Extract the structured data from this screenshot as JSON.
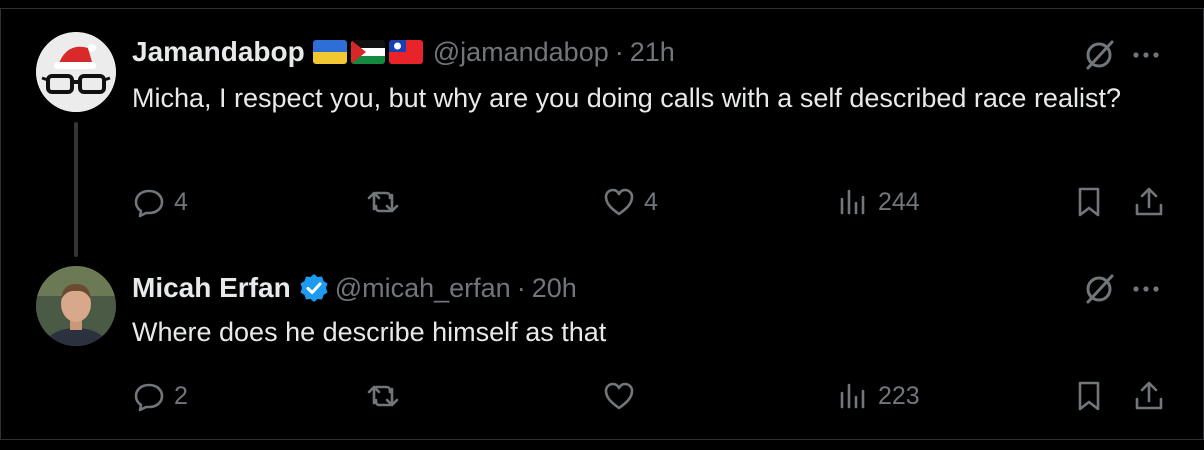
{
  "tweets": [
    {
      "name": "Jamandabop",
      "flags": [
        "ukraine-flag",
        "palestine-flag",
        "taiwan-flag"
      ],
      "handle": "@jamandabop",
      "separator": "·",
      "time": "21h",
      "text": "Micha, I respect you, but why are you doing calls with a self described race realist?",
      "replies": "4",
      "retweets": "",
      "likes": "4",
      "views": "244"
    },
    {
      "name": "Micah Erfan",
      "verified": true,
      "handle": "@micah_erfan",
      "separator": "·",
      "time": "20h",
      "text": "Where does he describe himself as that",
      "replies": "2",
      "retweets": "",
      "likes": "",
      "views": "223"
    }
  ],
  "colors": {
    "background": "#000000",
    "text": "#e7e9ea",
    "muted": "#71767b",
    "verified": "#1d9bf0",
    "divider": "#2f3336"
  }
}
